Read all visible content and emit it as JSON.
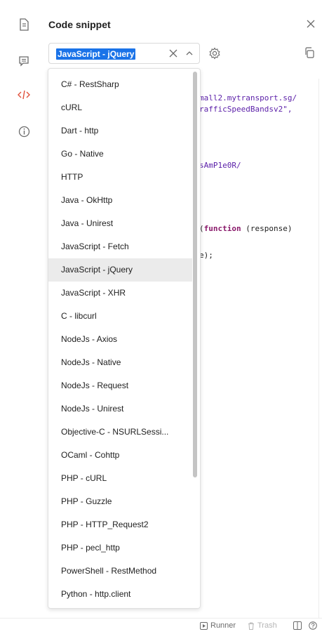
{
  "panel": {
    "title": "Code snippet"
  },
  "language_select": {
    "selected": "JavaScript - jQuery"
  },
  "dropdown": {
    "options": [
      "C# - RestSharp",
      "cURL",
      "Dart - http",
      "Go - Native",
      "HTTP",
      "Java - OkHttp",
      "Java - Unirest",
      "JavaScript - Fetch",
      "JavaScript - jQuery",
      "JavaScript - XHR",
      "C - libcurl",
      "NodeJs - Axios",
      "NodeJs - Native",
      "NodeJs - Request",
      "NodeJs - Unirest",
      "Objective-C - NSURLSessi...",
      "OCaml - Cohttp",
      "PHP - cURL",
      "PHP - Guzzle",
      "PHP - HTTP_Request2",
      "PHP - pecl_http",
      "PowerShell - RestMethod",
      "Python - http.client"
    ],
    "selected_index": 8
  },
  "code": {
    "line1": "mall2.mytransport.sg/",
    "line2": "rafficSpeedBandsv2\",",
    "line3": "sAmP1e0R/",
    "line4_kw": "function",
    "line4_rest": " (response)",
    "line5": "e);"
  },
  "bottom_bar": {
    "runner": "Runner",
    "trash": "Trash"
  },
  "colors": {
    "accent": "#1a73e8",
    "code_tag": "#e0513c"
  }
}
